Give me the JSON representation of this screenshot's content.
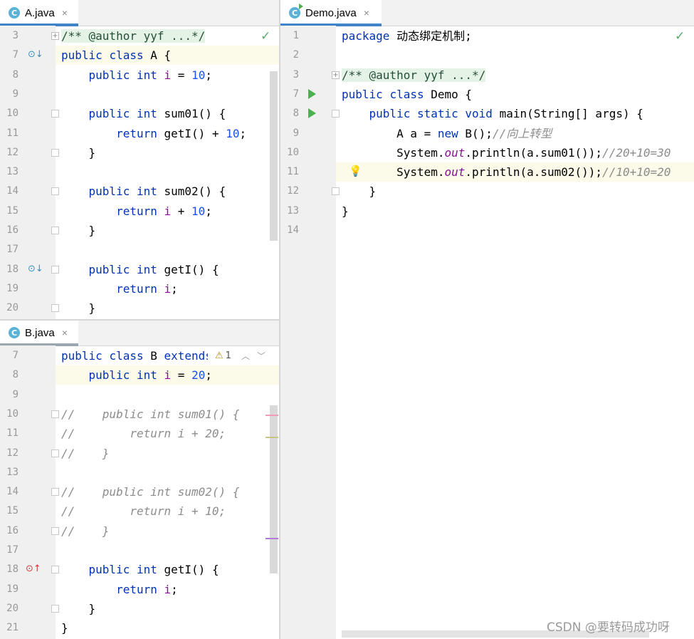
{
  "tabs": {
    "a": {
      "name": "A.java",
      "icon": "class-icon",
      "icon_letter": "C",
      "close": "×"
    },
    "b": {
      "name": "B.java",
      "icon": "class-icon",
      "icon_letter": "C",
      "close": "×"
    },
    "demo": {
      "name": "Demo.java",
      "icon": "runnable-class-icon",
      "icon_letter": "C",
      "close": "×"
    }
  },
  "a_editor": {
    "lines": [
      {
        "n": "3",
        "code": "/** @author yyf ...*/"
      },
      {
        "n": "7",
        "code": "public class A {"
      },
      {
        "n": "8",
        "code": "    public int i = 10;"
      },
      {
        "n": "9",
        "code": ""
      },
      {
        "n": "10",
        "code": "    public int sum01() {"
      },
      {
        "n": "11",
        "code": "        return getI() + 10;"
      },
      {
        "n": "12",
        "code": "    }"
      },
      {
        "n": "13",
        "code": ""
      },
      {
        "n": "14",
        "code": "    public int sum02() {"
      },
      {
        "n": "15",
        "code": "        return i + 10;"
      },
      {
        "n": "16",
        "code": "    }"
      },
      {
        "n": "17",
        "code": ""
      },
      {
        "n": "18",
        "code": "    public int getI() {"
      },
      {
        "n": "19",
        "code": "        return i;"
      },
      {
        "n": "20",
        "code": "    }"
      }
    ]
  },
  "b_editor": {
    "lines": [
      {
        "n": "7",
        "code": "public class B extends A {"
      },
      {
        "n": "8",
        "code": "    public int i = 20;"
      },
      {
        "n": "9",
        "code": ""
      },
      {
        "n": "10",
        "code": "//    public int sum01() {"
      },
      {
        "n": "11",
        "code": "//        return i + 20;"
      },
      {
        "n": "12",
        "code": "//    }"
      },
      {
        "n": "13",
        "code": ""
      },
      {
        "n": "14",
        "code": "//    public int sum02() {"
      },
      {
        "n": "15",
        "code": "//        return i + 10;"
      },
      {
        "n": "16",
        "code": "//    }"
      },
      {
        "n": "17",
        "code": ""
      },
      {
        "n": "18",
        "code": "    public int getI() {"
      },
      {
        "n": "19",
        "code": "        return i;"
      },
      {
        "n": "20",
        "code": "    }"
      },
      {
        "n": "21",
        "code": "}"
      }
    ],
    "warning_count": "1"
  },
  "demo_editor": {
    "lines": [
      {
        "n": "1",
        "code": "package 动态绑定机制;"
      },
      {
        "n": "2",
        "code": ""
      },
      {
        "n": "3",
        "code": "/** @author yyf ...*/"
      },
      {
        "n": "7",
        "code": "public class Demo {"
      },
      {
        "n": "8",
        "code": "    public static void main(String[] args) {"
      },
      {
        "n": "9",
        "code": "        A a = new B();//向上转型"
      },
      {
        "n": "10",
        "code": "        System.out.println(a.sum01());//20+10=30"
      },
      {
        "n": "11",
        "code": "        System.out.println(a.sum02());//10+10=20"
      },
      {
        "n": "12",
        "code": "    }"
      },
      {
        "n": "13",
        "code": "}"
      },
      {
        "n": "14",
        "code": ""
      }
    ]
  },
  "colors": {
    "keyword": "#0033b3",
    "number": "#1750eb",
    "field": "#871094",
    "comment": "#8c8c8c",
    "accent": "#4083c9",
    "ok": "#59a869"
  },
  "watermark": "CSDN @要转码成功呀"
}
